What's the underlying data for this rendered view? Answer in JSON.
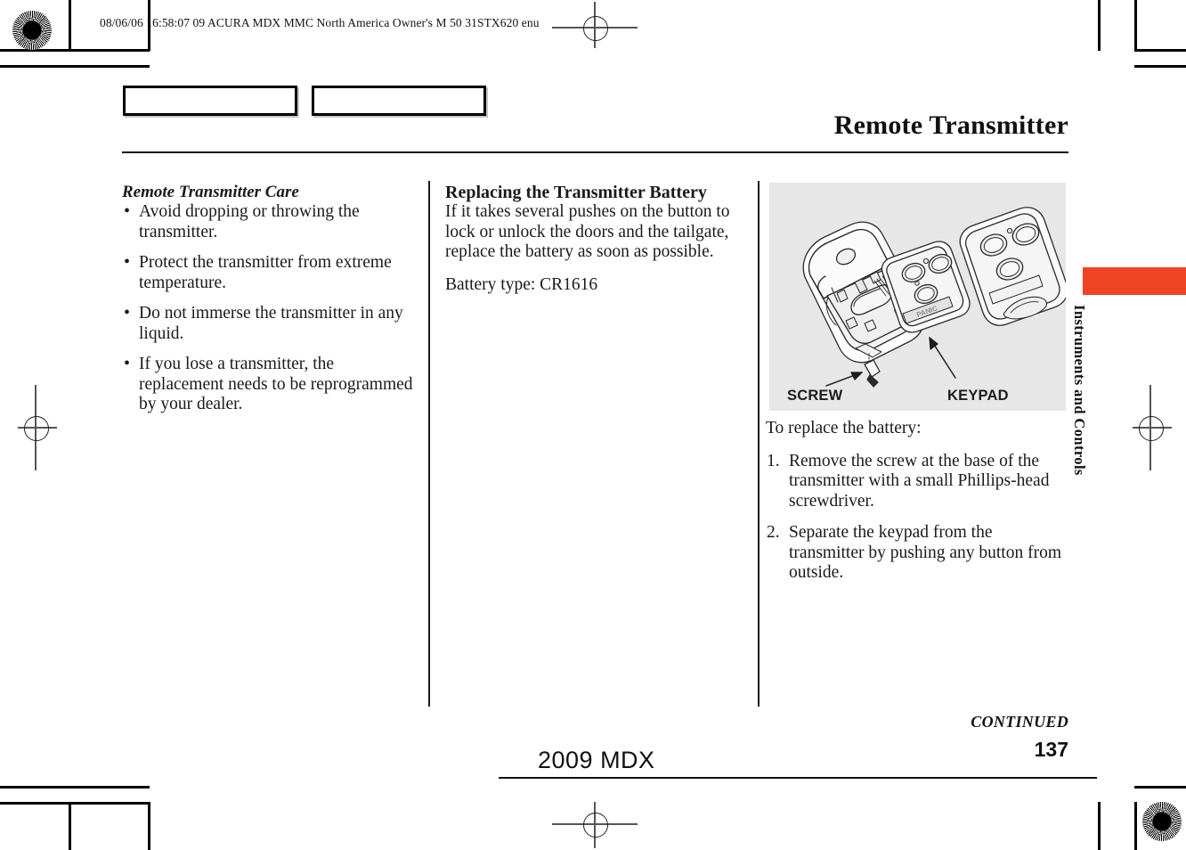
{
  "header": {
    "meta_line": "08/06/06 16:58:07    09 ACURA MDX MMC North America Owner's M 50 31STX620 enu",
    "title": "Remote Transmitter"
  },
  "left_column": {
    "heading": "Remote Transmitter Care",
    "bullets": [
      "Avoid dropping or throwing the transmitter.",
      "Protect the transmitter from extreme temperature.",
      "Do not immerse the transmitter in any liquid.",
      "If you lose a transmitter, the replacement needs to be reprogrammed by your dealer."
    ]
  },
  "middle_column": {
    "heading": "Replacing the Transmitter Battery",
    "paragraph": "If it takes several pushes on the button to lock or unlock the doors and the tailgate, replace the battery as soon as possible.",
    "battery_type": "Battery type: CR1616"
  },
  "right_column": {
    "figure": {
      "label_screw": "SCREW",
      "label_keypad": "KEYPAD",
      "keypad_panic_text": "PANIC",
      "background_color": "#e7e7e7"
    },
    "intro": "To replace the battery:",
    "steps": [
      "Remove the screw at the base of the transmitter with a small Phillips-head screwdriver.",
      "Separate the keypad from the transmitter by pushing any button from outside."
    ]
  },
  "side_tab": {
    "label": "Instruments and Controls",
    "color": "#ef4423"
  },
  "footer": {
    "continued": "CONTINUED",
    "page_number": "137",
    "model": "2009  MDX"
  }
}
